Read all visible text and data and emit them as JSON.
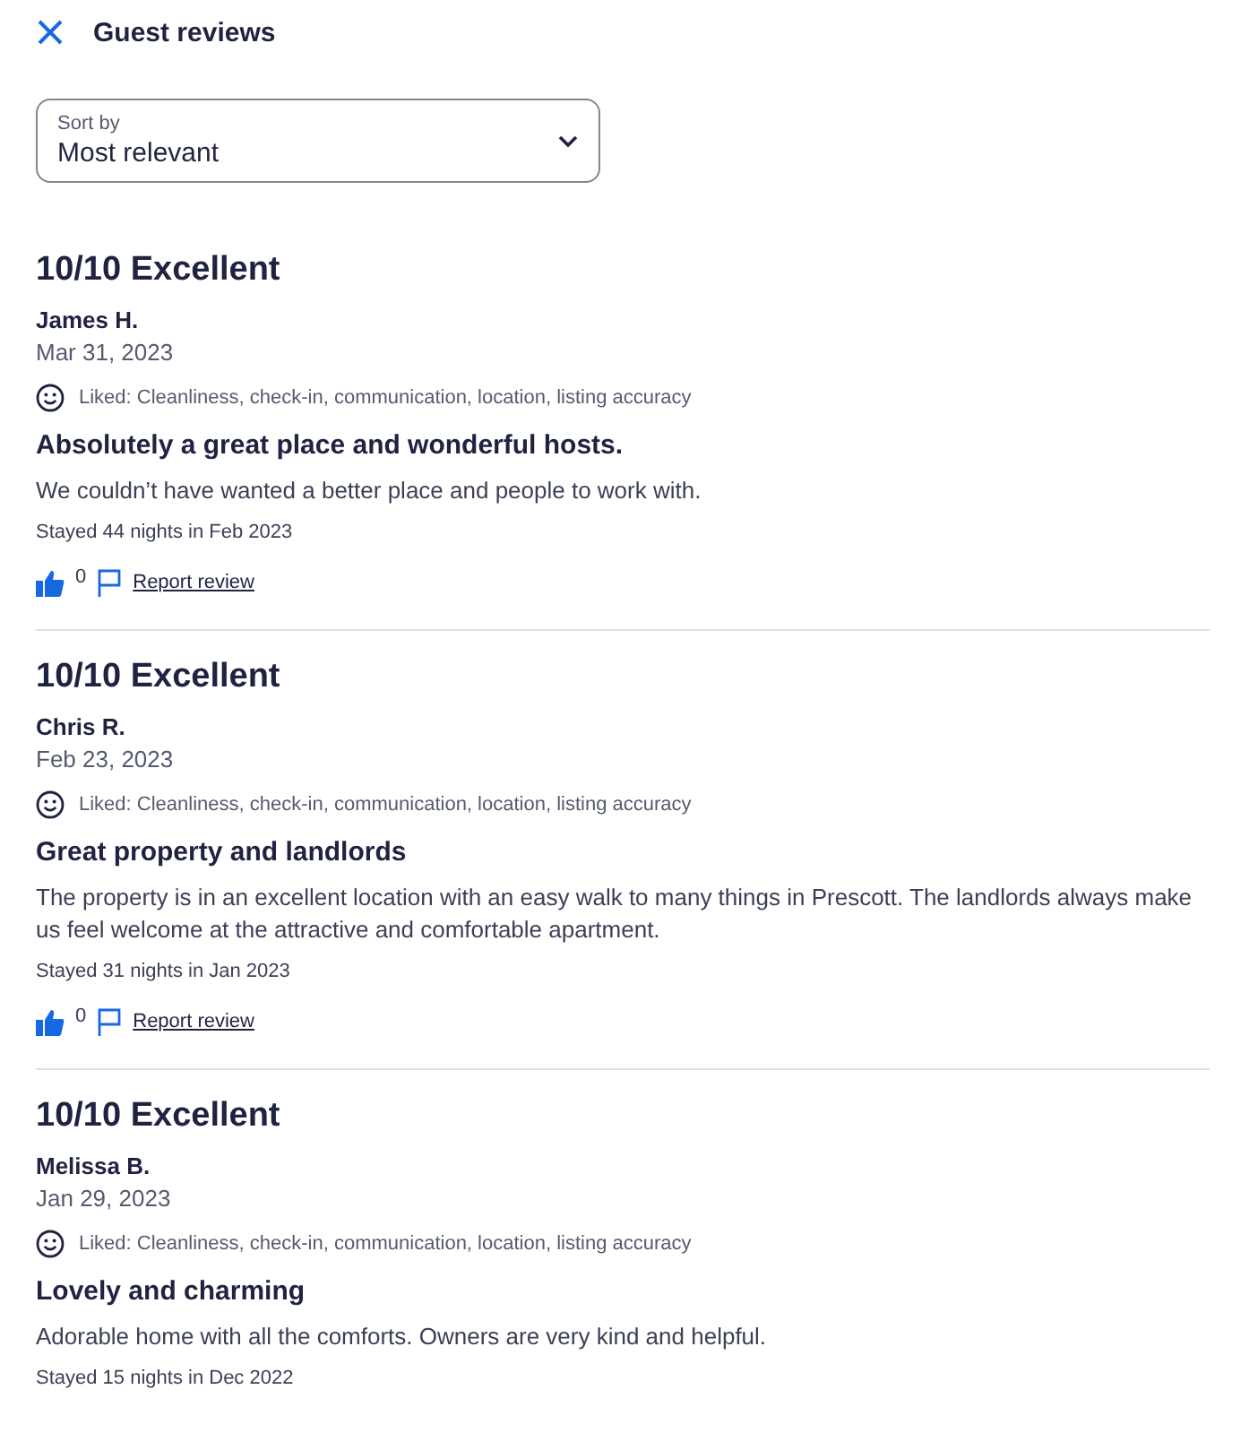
{
  "header": {
    "title": "Guest reviews"
  },
  "sort": {
    "label": "Sort by",
    "value": "Most relevant"
  },
  "reviews": [
    {
      "rating": "10/10 Excellent",
      "author": "James H.",
      "date": "Mar 31, 2023",
      "liked": "Liked: Cleanliness, check-in, communication, location, listing accuracy",
      "title": "Absolutely a great place and wonderful hosts.",
      "body": "We couldn’t have wanted a better place and people to work with.",
      "stay": "Stayed 44 nights in Feb 2023",
      "helpful_count": "0",
      "report": "Report review"
    },
    {
      "rating": "10/10 Excellent",
      "author": "Chris R.",
      "date": "Feb 23, 2023",
      "liked": "Liked: Cleanliness, check-in, communication, location, listing accuracy",
      "title": "Great property and landlords",
      "body": "The property is in an excellent location with an easy walk to many things in Prescott. The landlords always make us feel welcome at the attractive and comfortable apartment.",
      "stay": "Stayed 31 nights in Jan 2023",
      "helpful_count": "0",
      "report": "Report review"
    },
    {
      "rating": "10/10 Excellent",
      "author": "Melissa B.",
      "date": "Jan 29, 2023",
      "liked": "Liked: Cleanliness, check-in, communication, location, listing accuracy",
      "title": "Lovely and charming",
      "body": "Adorable home with all the comforts. Owners are very kind and helpful.",
      "stay": "Stayed 15 nights in Dec 2022"
    }
  ]
}
